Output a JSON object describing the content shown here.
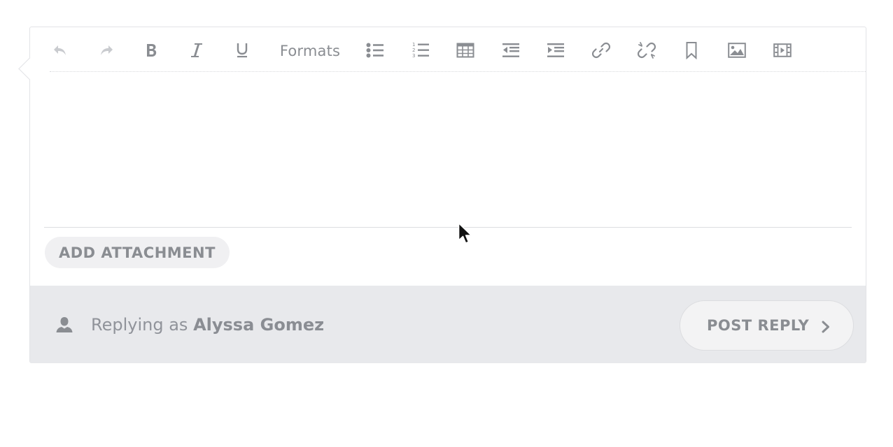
{
  "toolbar": {
    "buttons": [
      {
        "name": "undo-button",
        "icon": "undo-icon"
      },
      {
        "name": "redo-button",
        "icon": "redo-icon"
      },
      {
        "name": "bold-button",
        "icon": "bold-icon"
      },
      {
        "name": "italic-button",
        "icon": "italic-icon"
      },
      {
        "name": "underline-button",
        "icon": "underline-icon"
      }
    ],
    "formats_label": "Formats"
  },
  "editor": {
    "content": ""
  },
  "attachment": {
    "button_label": "ADD ATTACHMENT"
  },
  "footer": {
    "replying_prefix": "Replying as",
    "user_name": "Alyssa Gomez",
    "post_label": "POST REPLY"
  },
  "colors": {
    "icon_gray": "#8a8d92",
    "disabled_icon": "#c4c6ca",
    "footer_bg": "#e8e9ec",
    "border": "#e2e3e6"
  }
}
